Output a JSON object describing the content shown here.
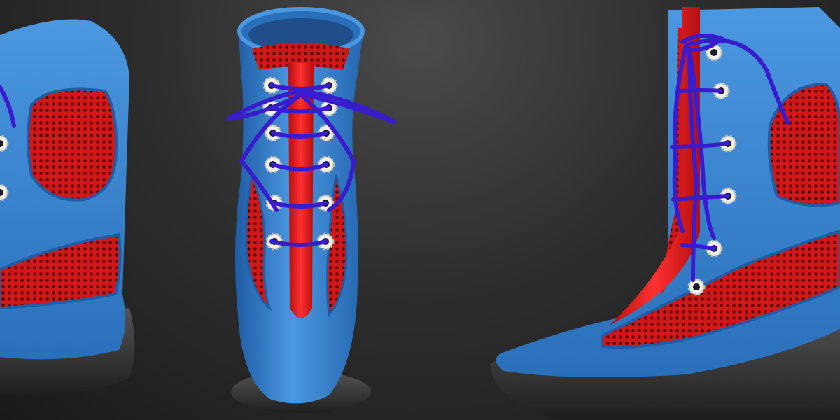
{
  "scene": {
    "colors": {
      "background_top": "#4a4a4a",
      "background_bottom": "#1a1a1a",
      "boot_blue": "#3b87d4",
      "boot_blue_dark": "#1f5da6",
      "mesh_red": "#d11818",
      "mesh_red_dark": "#8e0b0b",
      "stripe_red": "#e01a1a",
      "lace_purple": "#3a1ccf",
      "sole_grey": "#3a3a3a",
      "eyelet_white": "#f0f0e8"
    },
    "views": [
      {
        "name": "side-view-left",
        "icon": "boot-icon"
      },
      {
        "name": "front-view",
        "icon": "boot-icon"
      },
      {
        "name": "side-view-right",
        "icon": "boot-icon"
      }
    ]
  }
}
